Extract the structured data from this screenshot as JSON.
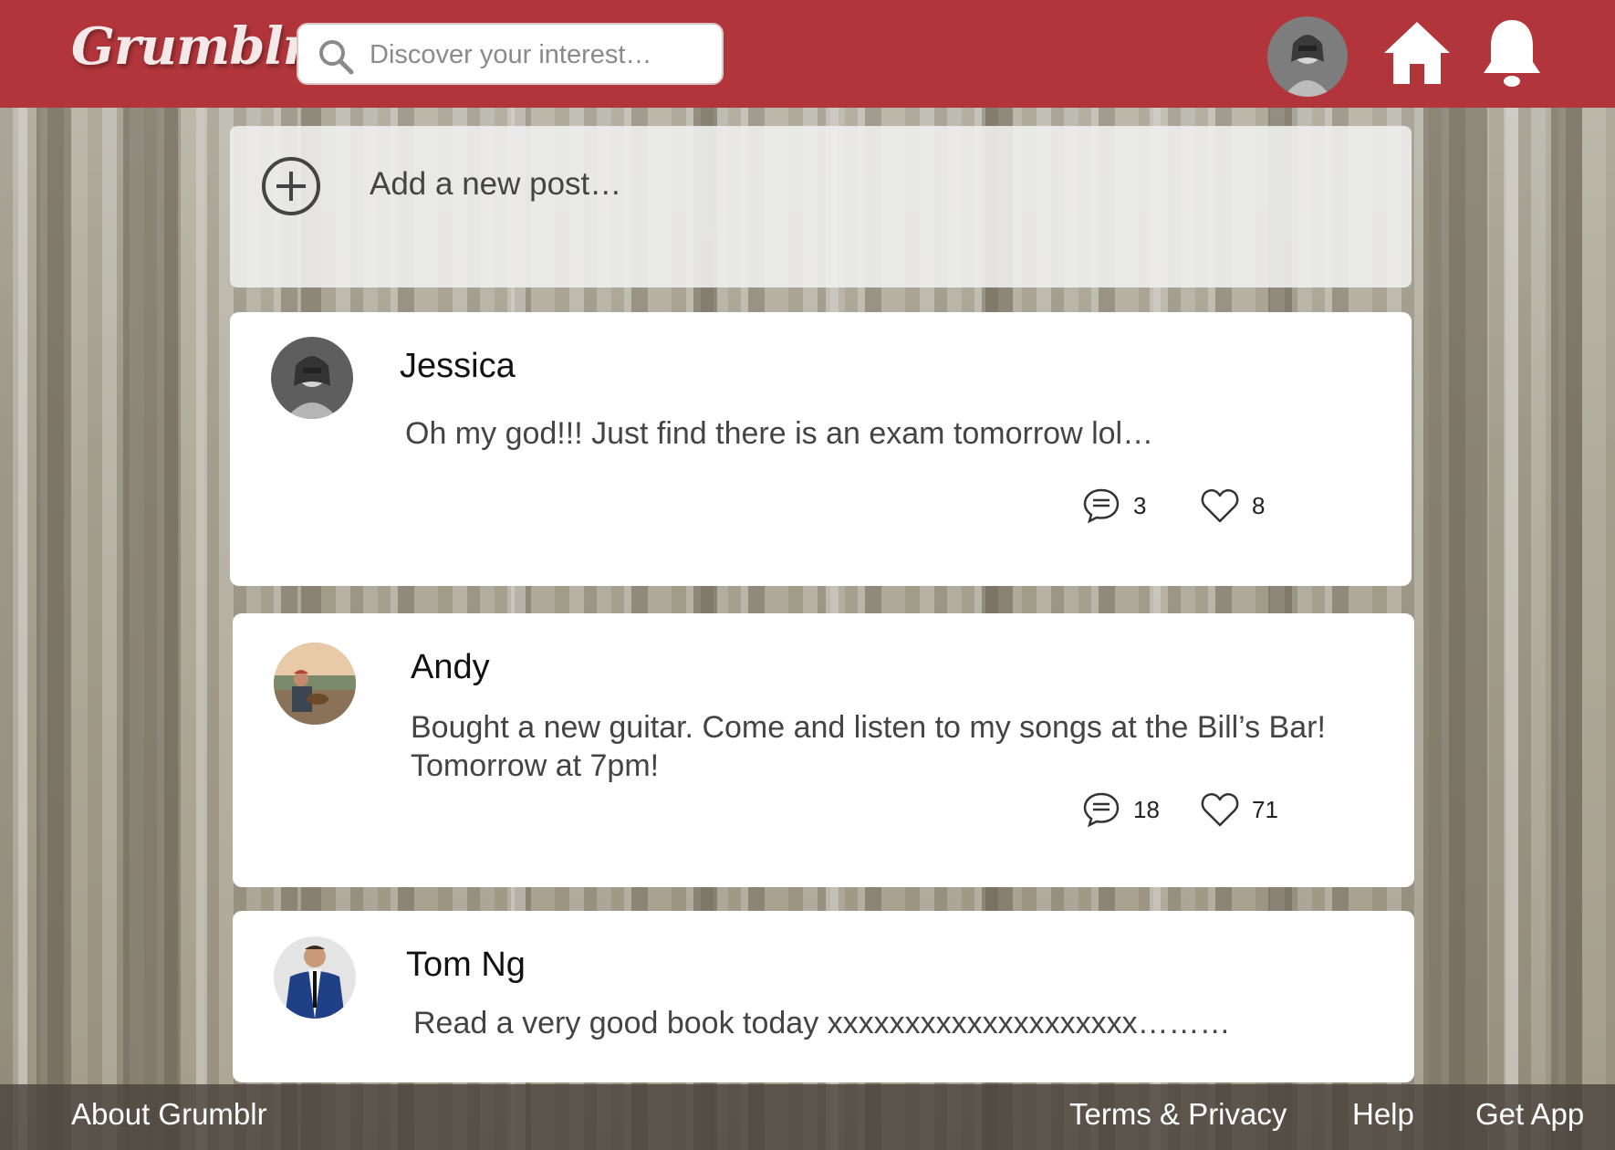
{
  "header": {
    "logo": "Grumblr",
    "search_placeholder": "Discover your interest…",
    "brand_color": "#b1353a"
  },
  "composer": {
    "placeholder": "Add a new post…"
  },
  "posts": [
    {
      "name": "Jessica",
      "text": "Oh my god!!! Just find there is an exam tomorrow lol…",
      "comments": "3",
      "likes": "8"
    },
    {
      "name": "Andy",
      "text": "Bought a new guitar. Come and listen to my songs at the Bill’s Bar! Tomorrow at 7pm!",
      "comments": "18",
      "likes": "71"
    },
    {
      "name": "Tom Ng",
      "text": "Read a very good book today xxxxxxxxxxxxxxxxxxxx………"
    }
  ],
  "footer": {
    "about": "About Grumblr",
    "terms": "Terms & Privacy",
    "help": "Help",
    "get_app": "Get App"
  },
  "icons": [
    "search-icon",
    "home-icon",
    "bell-icon",
    "plus-circle-icon",
    "comment-icon",
    "heart-icon"
  ]
}
